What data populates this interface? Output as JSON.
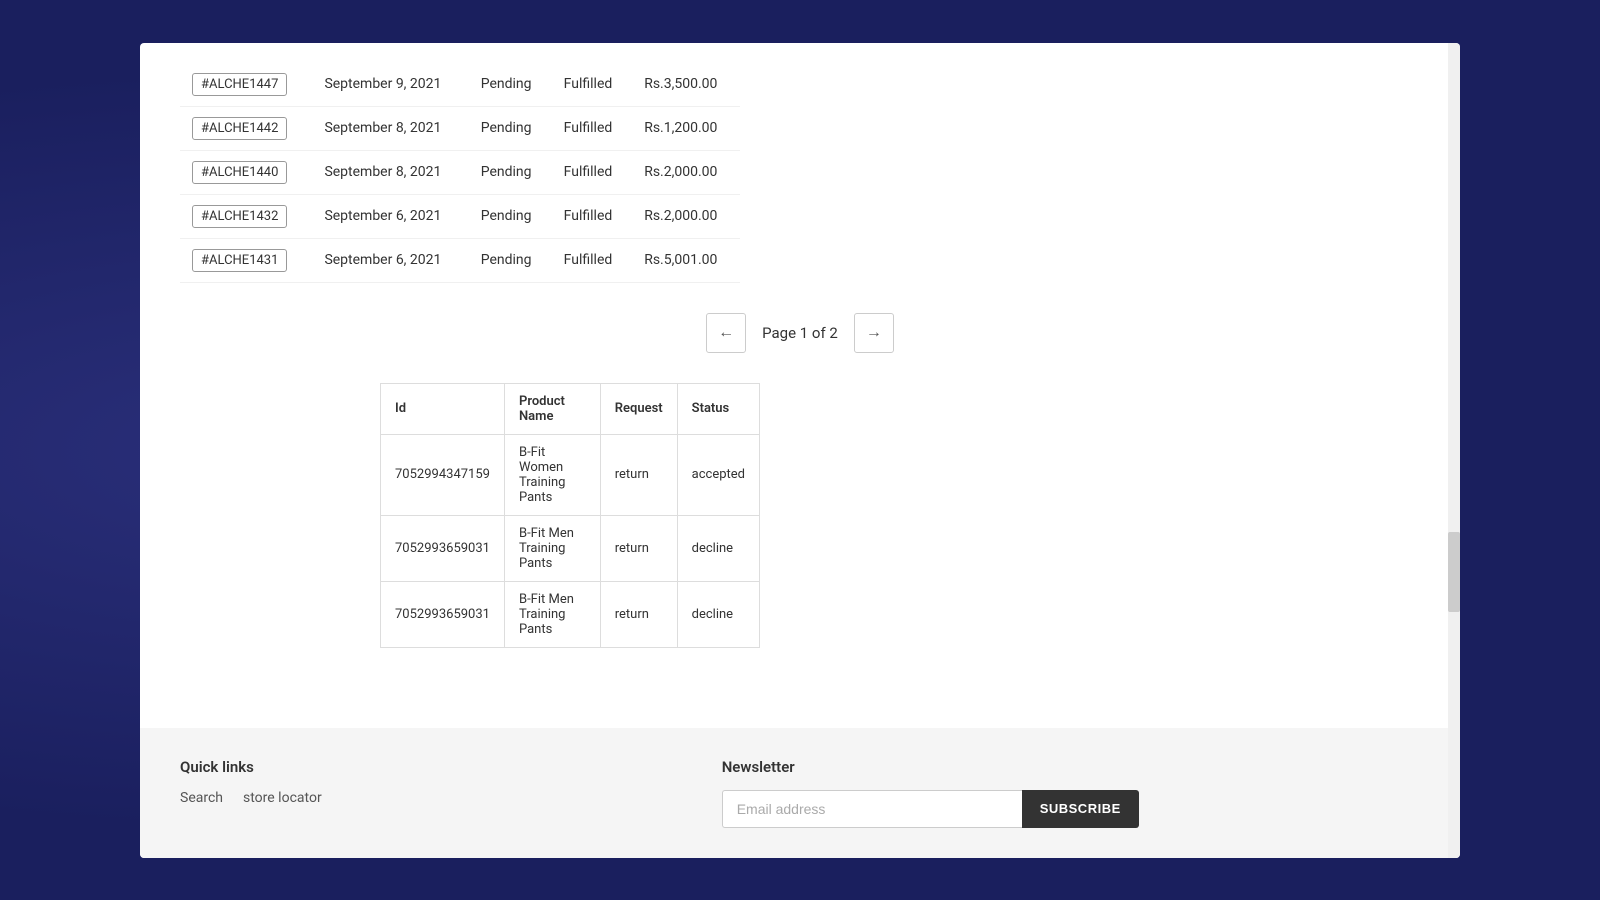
{
  "background": {
    "color": "#1a1f5e"
  },
  "orders": {
    "rows": [
      {
        "id": "#ALCHE1447",
        "date": "September 9, 2021",
        "payment": "Pending",
        "fulfillment": "Fulfilled",
        "total": "Rs.3,500.00"
      },
      {
        "id": "#ALCHE1442",
        "date": "September 8, 2021",
        "payment": "Pending",
        "fulfillment": "Fulfilled",
        "total": "Rs.1,200.00"
      },
      {
        "id": "#ALCHE1440",
        "date": "September 8, 2021",
        "payment": "Pending",
        "fulfillment": "Fulfilled",
        "total": "Rs.2,000.00"
      },
      {
        "id": "#ALCHE1432",
        "date": "September 6, 2021",
        "payment": "Pending",
        "fulfillment": "Fulfilled",
        "total": "Rs.2,000.00"
      },
      {
        "id": "#ALCHE1431",
        "date": "September 6, 2021",
        "payment": "Pending",
        "fulfillment": "Fulfilled",
        "total": "Rs.5,001.00"
      }
    ]
  },
  "pagination": {
    "text": "Page 1 of 2",
    "prev_arrow": "←",
    "next_arrow": "→"
  },
  "returns_table": {
    "columns": [
      "Id",
      "Product Name",
      "Request",
      "Status"
    ],
    "rows": [
      {
        "id": "7052994347159",
        "product_name": "B-Fit Women Training Pants",
        "request": "return",
        "status": "accepted"
      },
      {
        "id": "7052993659031",
        "product_name": "B-Fit Men Training Pants",
        "request": "return",
        "status": "decline"
      },
      {
        "id": "7052993659031",
        "product_name": "B-Fit Men Training Pants",
        "request": "return",
        "status": "decline"
      }
    ]
  },
  "footer": {
    "quick_links": {
      "heading": "Quick links",
      "links": [
        "Search",
        "store locator"
      ]
    },
    "newsletter": {
      "heading": "Newsletter",
      "email_placeholder": "Email address",
      "subscribe_label": "SUBSCRIBE"
    }
  }
}
